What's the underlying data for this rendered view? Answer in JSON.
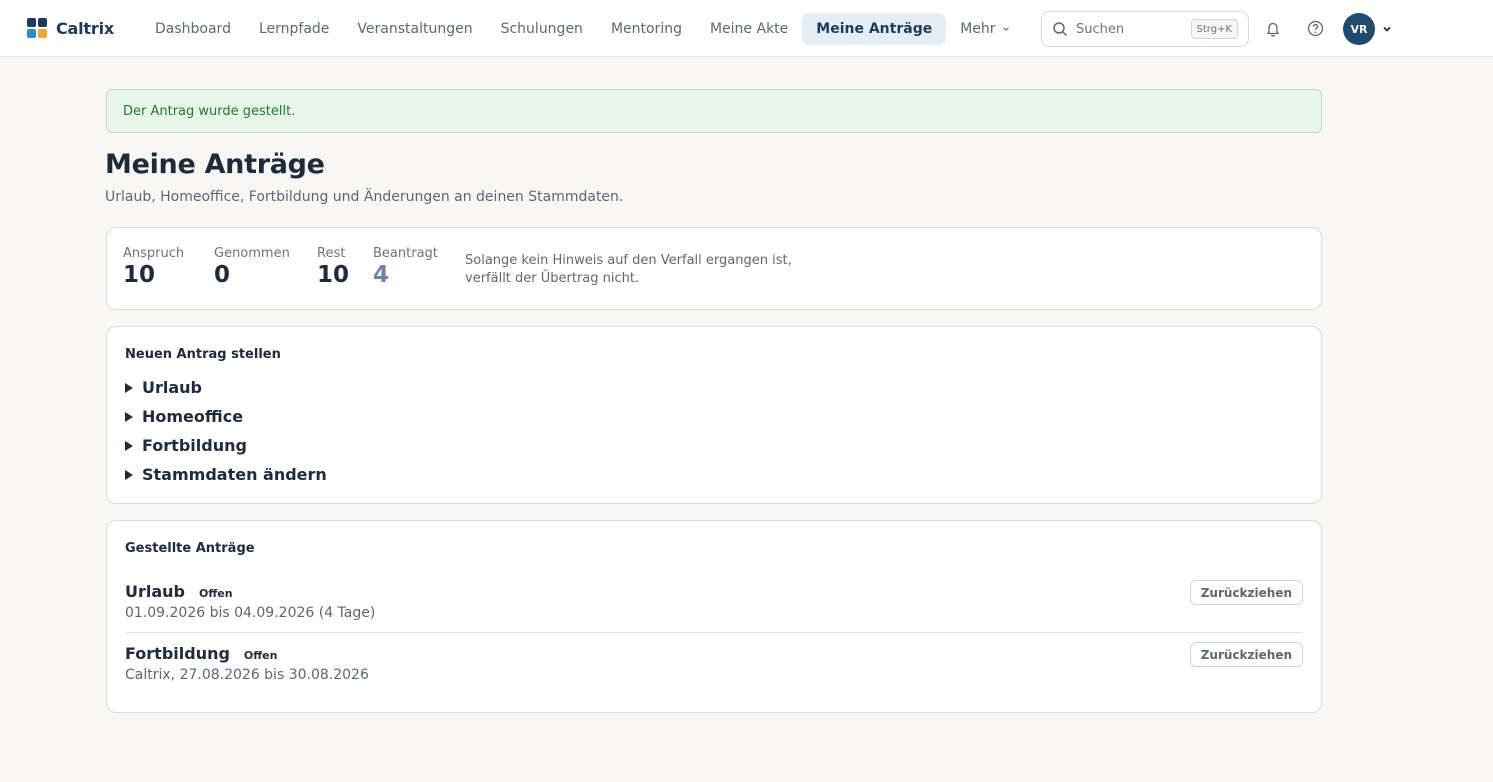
{
  "app": {
    "name": "Caltrix",
    "logo_colors": [
      "#1e3a5f",
      "#1e3a5f",
      "#2e8bd1",
      "#f2a52f"
    ]
  },
  "nav": {
    "items": [
      {
        "label": "Dashboard"
      },
      {
        "label": "Lernpfade"
      },
      {
        "label": "Veranstaltungen"
      },
      {
        "label": "Schulungen"
      },
      {
        "label": "Mentoring"
      },
      {
        "label": "Meine Akte"
      },
      {
        "label": "Meine Anträge",
        "active": true
      },
      {
        "label": "Mehr",
        "icon": "chevron-down-icon"
      }
    ]
  },
  "search": {
    "placeholder": "Suchen",
    "shortcut": "Strg+K"
  },
  "user": {
    "initials": "VR"
  },
  "alert": {
    "message": "Der Antrag wurde gestellt.",
    "color": "#1f7a32"
  },
  "page": {
    "title": "Meine Anträge",
    "subtitle": "Urlaub, Homeoffice, Fortbildung und Änderungen an deinen Stammdaten."
  },
  "stats": {
    "items": [
      {
        "label": "Anspruch",
        "value": "10"
      },
      {
        "label": "Genommen",
        "value": "0"
      },
      {
        "label": "Rest",
        "value": "10"
      },
      {
        "label": "Beantragt",
        "value": "4"
      }
    ],
    "note_line1": "Solange kein Hinweis auf den Verfall ergangen ist,",
    "note_line2": "verfällt der Übertrag nicht."
  },
  "new_request": {
    "title": "Neuen Antrag stellen",
    "options": [
      "Urlaub",
      "Homeoffice",
      "Fortbildung",
      "Stammdaten ändern"
    ]
  },
  "submitted": {
    "title": "Gestellte Anträge",
    "rows": [
      {
        "type": "Urlaub",
        "status": "Offen",
        "detail": "01.09.2026 bis 04.09.2026 (4 Tage)",
        "action": "Zurückziehen"
      },
      {
        "type": "Fortbildung",
        "status": "Offen",
        "detail": "Caltrix, 27.08.2026 bis 30.08.2026",
        "action": "Zurückziehen"
      }
    ]
  }
}
